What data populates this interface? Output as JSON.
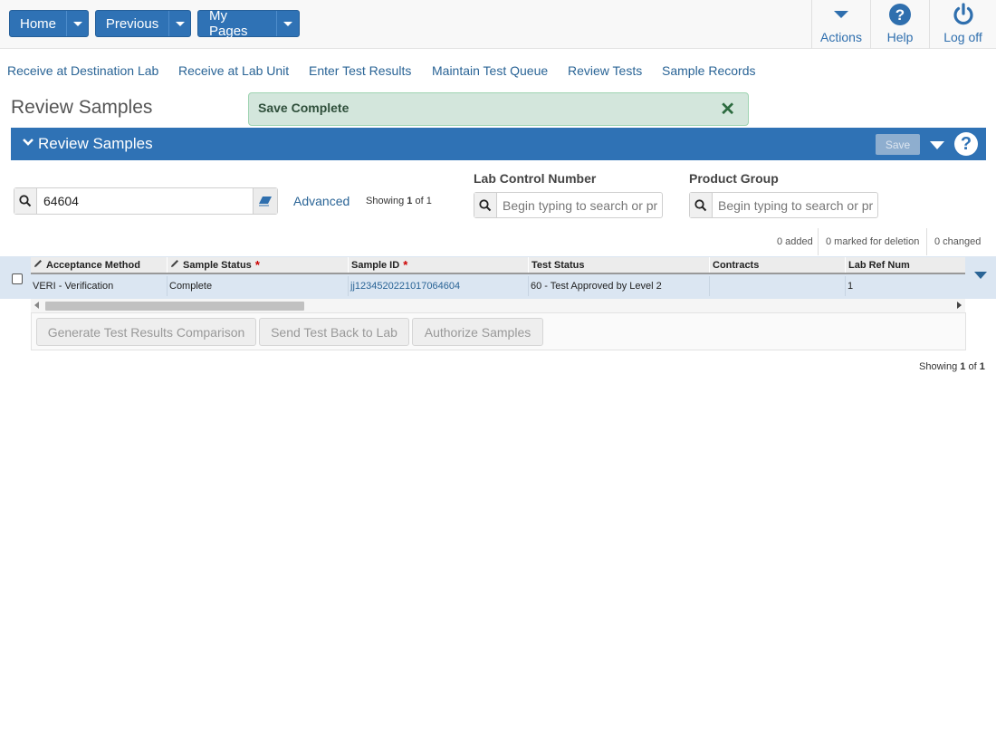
{
  "topnav": {
    "home": "Home",
    "previous": "Previous",
    "my_pages": "My Pages",
    "actions": "Actions",
    "help": "Help",
    "logoff": "Log off"
  },
  "links": [
    "Receive at Destination Lab",
    "Receive at Lab Unit",
    "Enter Test Results",
    "Maintain Test Queue",
    "Review Tests",
    "Sample Records"
  ],
  "page_title": "Review Samples",
  "toast": {
    "message": "Save Complete",
    "close": "✕"
  },
  "section": {
    "title": "Review Samples",
    "save": "Save",
    "help": "?"
  },
  "search": {
    "value": "64604",
    "advanced": "Advanced",
    "showing_prefix": "Showing",
    "showing_a": "1",
    "showing_of": "of",
    "showing_b": "1"
  },
  "lab_control": {
    "label": "Lab Control Number",
    "placeholder": "Begin typing to search or pr"
  },
  "product_group": {
    "label": "Product Group",
    "placeholder": "Begin typing to search or pr"
  },
  "counts": {
    "added": "0 added",
    "deletion": "0 marked for deletion",
    "changed": "0 changed"
  },
  "grid": {
    "columns": [
      "Acceptance Method",
      "Sample Status",
      "Sample ID",
      "Test Status",
      "Contracts",
      "Lab Ref Num"
    ],
    "required_marker": "*",
    "row": {
      "acceptance_method": "VERI - Verification",
      "sample_status": "Complete",
      "sample_id": "jj1234520221017064604",
      "test_status": "60 - Test Approved by Level 2",
      "contracts": "",
      "lab_ref_num": "1"
    }
  },
  "actions": {
    "compare": "Generate Test Results Comparison",
    "send_back": "Send Test Back to Lab",
    "authorize": "Authorize Samples"
  },
  "showing_bottom": {
    "prefix": "Showing",
    "a": "1",
    "of": "of",
    "b": "1"
  },
  "colors": {
    "primary": "#2f72b5",
    "link": "#2a6496",
    "toast_bg": "#d3e6dc",
    "row_bg": "#dbe6f2"
  }
}
